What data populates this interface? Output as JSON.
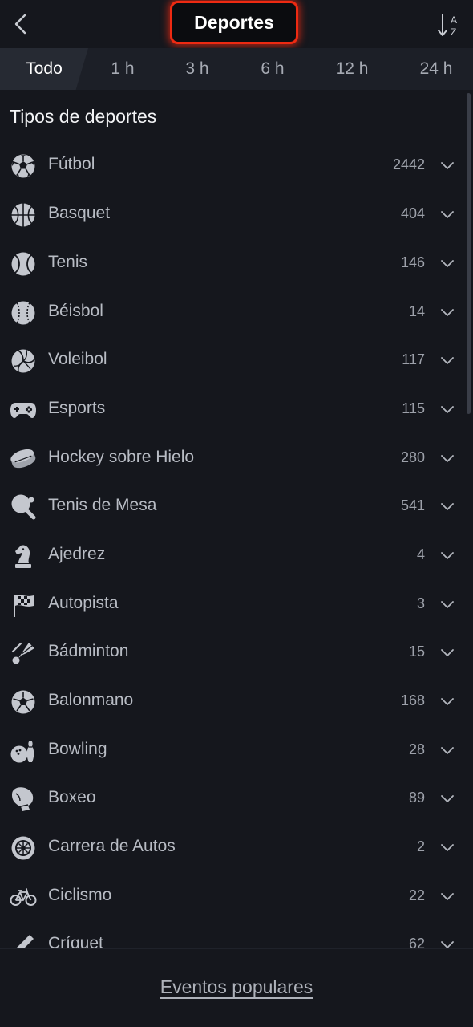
{
  "header": {
    "title": "Deportes",
    "back_icon": "chevron-left-icon",
    "sort_icon": "sort-alpha-icon",
    "sort_letters": [
      "A",
      "Z"
    ]
  },
  "tabs": [
    {
      "label": "Todo",
      "active": true
    },
    {
      "label": "1 h",
      "active": false
    },
    {
      "label": "3 h",
      "active": false
    },
    {
      "label": "6 h",
      "active": false
    },
    {
      "label": "12 h",
      "active": false
    },
    {
      "label": "24 h",
      "active": false
    }
  ],
  "section": {
    "title": "Tipos de deportes"
  },
  "sports": [
    {
      "label": "Fútbol",
      "count": "2442",
      "icon": "soccer-ball-icon"
    },
    {
      "label": "Basquet",
      "count": "404",
      "icon": "basketball-icon"
    },
    {
      "label": "Tenis",
      "count": "146",
      "icon": "tennis-ball-icon"
    },
    {
      "label": "Béisbol",
      "count": "14",
      "icon": "baseball-icon"
    },
    {
      "label": "Voleibol",
      "count": "117",
      "icon": "volleyball-icon"
    },
    {
      "label": "Esports",
      "count": "115",
      "icon": "gamepad-icon"
    },
    {
      "label": "Hockey sobre Hielo",
      "count": "280",
      "icon": "hockey-puck-icon"
    },
    {
      "label": "Tenis de Mesa",
      "count": "541",
      "icon": "ping-pong-icon"
    },
    {
      "label": "Ajedrez",
      "count": "4",
      "icon": "chess-knight-icon"
    },
    {
      "label": "Autopista",
      "count": "3",
      "icon": "checkered-flag-icon"
    },
    {
      "label": "Bádminton",
      "count": "15",
      "icon": "shuttlecock-icon"
    },
    {
      "label": "Balonmano",
      "count": "168",
      "icon": "handball-icon"
    },
    {
      "label": "Bowling",
      "count": "28",
      "icon": "bowling-icon"
    },
    {
      "label": "Boxeo",
      "count": "89",
      "icon": "boxing-glove-icon"
    },
    {
      "label": "Carrera de Autos",
      "count": "2",
      "icon": "car-wheel-icon"
    },
    {
      "label": "Ciclismo",
      "count": "22",
      "icon": "bicycle-icon"
    },
    {
      "label": "Críquet",
      "count": "62",
      "icon": "cricket-bat-icon"
    }
  ],
  "bottom": {
    "link_label": "Eventos populares"
  },
  "colors": {
    "background": "#15171d",
    "tab_bar": "#1c1f27",
    "highlight": "#ee2a12",
    "icon": "#c4c7ce"
  }
}
